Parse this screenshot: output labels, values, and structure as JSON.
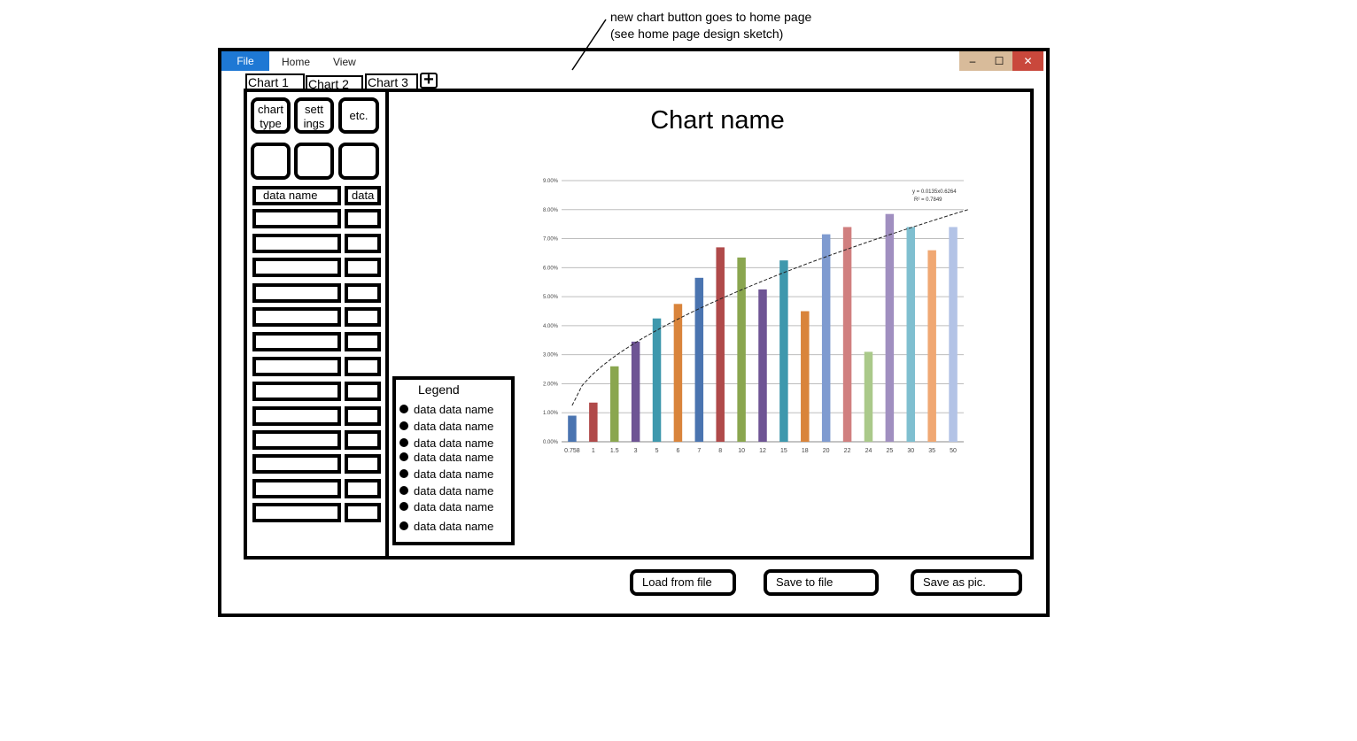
{
  "annotation": {
    "line1": "new chart button goes to home page",
    "line2": "(see home page design sketch)"
  },
  "menu": {
    "file": "File",
    "home": "Home",
    "view": "View"
  },
  "window_controls": {
    "minimize": "–",
    "maximize": "☐",
    "close": "✕"
  },
  "tabs": [
    {
      "label": "Chart 1"
    },
    {
      "label": "Chart 2"
    },
    {
      "label": "Chart 3"
    }
  ],
  "new_tab_icon": "+",
  "sidebar": {
    "chart_type_line1": "chart",
    "chart_type_line2": "type",
    "settings_line1": "sett",
    "settings_line2": "ings",
    "etc": "etc.",
    "data_name_header": "data name",
    "data_header": "data"
  },
  "legend": {
    "title": "Legend",
    "items": [
      "data data name",
      "data data name",
      "data data name",
      "data data name",
      "data data name",
      "data data name",
      "data data name",
      "data data name"
    ]
  },
  "footer": {
    "load": "Load from file",
    "save": "Save to file",
    "save_pic": "Save as pic."
  },
  "colors": {
    "file_menu": "#1e78d4",
    "close_button": "#c9483c",
    "window_button": "#d8bb9a"
  },
  "chart_data": {
    "type": "bar",
    "title": "Chart name",
    "categories": [
      "0.758",
      "1",
      "1.5",
      "3",
      "5",
      "6",
      "7",
      "8",
      "10",
      "12",
      "15",
      "18",
      "20",
      "22",
      "24",
      "25",
      "30",
      "35",
      "50"
    ],
    "values": [
      0.9,
      1.35,
      2.6,
      3.45,
      4.25,
      4.75,
      5.65,
      6.7,
      6.35,
      5.25,
      6.25,
      4.5,
      7.15,
      7.4,
      3.1,
      7.85,
      7.4,
      6.6,
      7.4
    ],
    "colors": [
      "#4a74b0",
      "#b04a4a",
      "#8aa64f",
      "#6e5494",
      "#3e98ad",
      "#d9843b",
      "#4a74b0",
      "#b04a4a",
      "#8aa64f",
      "#6e5494",
      "#3e98ad",
      "#d9843b",
      "#7f9bd0",
      "#d07f7f",
      "#aac98a",
      "#a08fc0",
      "#7fbfd0",
      "#f0a873",
      "#b3c3e6"
    ],
    "yticks": [
      "0.00%",
      "1.00%",
      "2.00%",
      "3.00%",
      "4.00%",
      "5.00%",
      "6.00%",
      "7.00%",
      "8.00%",
      "9.00%"
    ],
    "ylim": [
      0,
      9
    ],
    "trendline": {
      "equation": "y = 0.0135x0.6264",
      "r_squared": "R² = 0.7849",
      "start": 1.25,
      "end": 8.0
    },
    "grid": true
  }
}
